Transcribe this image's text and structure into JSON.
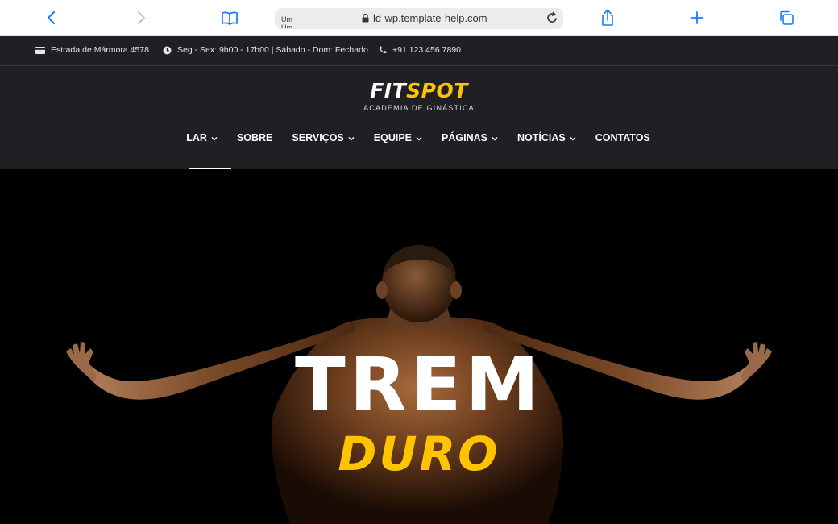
{
  "browser": {
    "tab_label": "Um Um",
    "url": "ld-wp.template-help.com",
    "icons": [
      "back-icon",
      "forward-icon",
      "bookmarks-icon",
      "lock-icon",
      "reload-icon",
      "share-icon",
      "new-tab-icon",
      "tabs-icon"
    ]
  },
  "topbar": {
    "address": "Estrada de Mármora 4578",
    "hours": "Seg - Sex: 9h00 - 17h00 | Sábado - Dom: Fechado",
    "phone": "+91 123 456 7890"
  },
  "logo": {
    "word_fit": "FIT",
    "word_spot": "SPOT",
    "tagline": "ACADEMIA DE GINÁSTICA"
  },
  "nav": {
    "items": [
      {
        "label": "LAR",
        "dropdown": true
      },
      {
        "label": "SOBRE",
        "dropdown": false
      },
      {
        "label": "SERVIÇOS",
        "dropdown": true
      },
      {
        "label": "EQUIPE",
        "dropdown": true
      },
      {
        "label": "PÁGINAS",
        "dropdown": true
      },
      {
        "label": "NOTÍCIAS",
        "dropdown": true
      },
      {
        "label": "CONTATOS",
        "dropdown": false
      }
    ],
    "active": "LAR"
  },
  "hero": {
    "title": "TREM",
    "subtitle": "DURO"
  },
  "colors": {
    "accent": "#ffc300",
    "header_bg": "#1f2024",
    "browser_blue": "#1a7cf0"
  }
}
